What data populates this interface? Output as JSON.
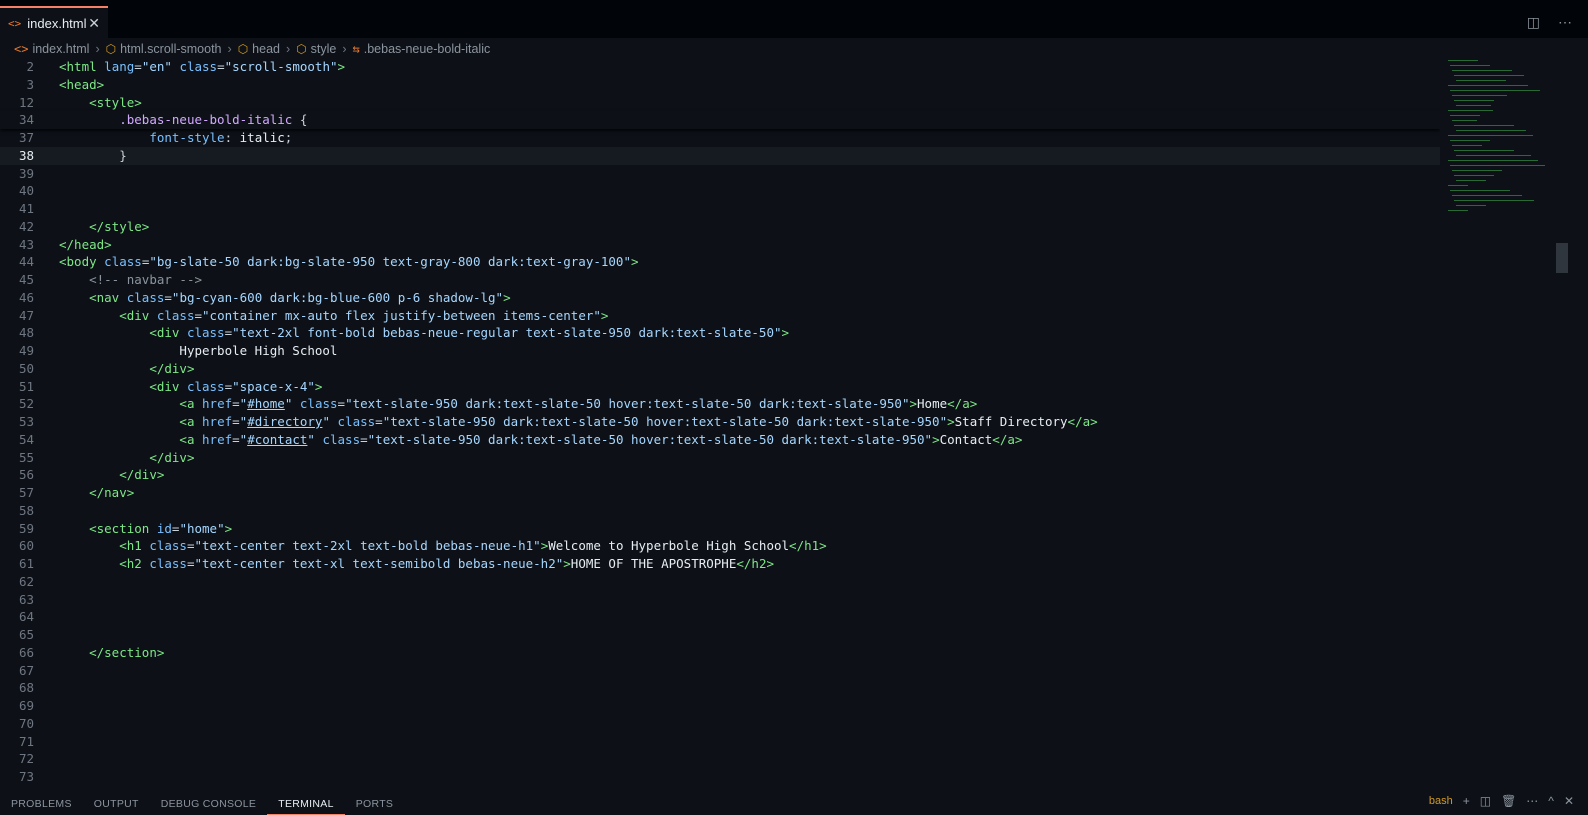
{
  "tab": {
    "icon": "<>",
    "title": "index.html",
    "close": "✕"
  },
  "tab_actions": {
    "split": "◫",
    "more": "⋯"
  },
  "breadcrumb": [
    {
      "icon": "<>",
      "label": "index.html"
    },
    {
      "icon": "⬡",
      "label": "html.scroll-smooth"
    },
    {
      "icon": "⬡",
      "label": "head"
    },
    {
      "icon": "⬡",
      "label": "style"
    },
    {
      "icon": "⇆",
      "label": ".bebas-neue-bold-italic"
    }
  ],
  "lines": [
    {
      "n": "2",
      "t": [
        [
          "tag",
          "<html"
        ],
        [
          "punc",
          " "
        ],
        [
          "attr",
          "lang"
        ],
        [
          "punc",
          "="
        ],
        [
          "str",
          "\"en\""
        ],
        [
          "punc",
          " "
        ],
        [
          "attr",
          "class"
        ],
        [
          "punc",
          "="
        ],
        [
          "str",
          "\"scroll-smooth\""
        ],
        [
          "tag",
          ">"
        ]
      ]
    },
    {
      "n": "3",
      "t": [
        [
          "tag",
          "<head>"
        ]
      ]
    },
    {
      "n": "12",
      "t": [
        [
          "punc",
          "    "
        ],
        [
          "tag",
          "<style>"
        ]
      ]
    },
    {
      "n": "34",
      "t": [
        [
          "punc",
          "        "
        ],
        [
          "sel",
          ".bebas-neue-bold-italic"
        ],
        [
          "punc",
          " {"
        ]
      ]
    },
    {
      "n": "37",
      "t": [
        [
          "punc",
          "            "
        ],
        [
          "prop",
          "font-style"
        ],
        [
          "punc",
          ": "
        ],
        [
          "txt",
          "italic"
        ],
        [
          "punc",
          ";"
        ]
      ]
    },
    {
      "n": "38",
      "t": [
        [
          "punc",
          "        }"
        ]
      ],
      "current": true
    },
    {
      "n": "39",
      "t": []
    },
    {
      "n": "40",
      "t": []
    },
    {
      "n": "41",
      "t": []
    },
    {
      "n": "42",
      "t": [
        [
          "punc",
          "    "
        ],
        [
          "tag",
          "</style>"
        ]
      ]
    },
    {
      "n": "43",
      "t": [
        [
          "tag",
          "</head>"
        ]
      ]
    },
    {
      "n": "44",
      "t": [
        [
          "tag",
          "<body"
        ],
        [
          "punc",
          " "
        ],
        [
          "attr",
          "class"
        ],
        [
          "punc",
          "="
        ],
        [
          "str",
          "\"bg-slate-50 dark:bg-slate-950 text-gray-800 dark:text-gray-100\""
        ],
        [
          "tag",
          ">"
        ]
      ]
    },
    {
      "n": "45",
      "t": [
        [
          "punc",
          "    "
        ],
        [
          "cmt",
          "<!-- navbar -->"
        ]
      ]
    },
    {
      "n": "46",
      "t": [
        [
          "punc",
          "    "
        ],
        [
          "tag",
          "<nav"
        ],
        [
          "punc",
          " "
        ],
        [
          "attr",
          "class"
        ],
        [
          "punc",
          "="
        ],
        [
          "str",
          "\"bg-cyan-600 dark:bg-blue-600 p-6 shadow-lg\""
        ],
        [
          "tag",
          ">"
        ]
      ]
    },
    {
      "n": "47",
      "t": [
        [
          "punc",
          "        "
        ],
        [
          "tag",
          "<div"
        ],
        [
          "punc",
          " "
        ],
        [
          "attr",
          "class"
        ],
        [
          "punc",
          "="
        ],
        [
          "str",
          "\"container mx-auto flex justify-between items-center\""
        ],
        [
          "tag",
          ">"
        ]
      ]
    },
    {
      "n": "48",
      "t": [
        [
          "punc",
          "            "
        ],
        [
          "tag",
          "<div"
        ],
        [
          "punc",
          " "
        ],
        [
          "attr",
          "class"
        ],
        [
          "punc",
          "="
        ],
        [
          "str",
          "\"text-2xl font-bold bebas-neue-regular text-slate-950 dark:text-slate-50\""
        ],
        [
          "tag",
          ">"
        ]
      ]
    },
    {
      "n": "49",
      "t": [
        [
          "punc",
          "                "
        ],
        [
          "txt",
          "Hyperbole High School"
        ]
      ]
    },
    {
      "n": "50",
      "t": [
        [
          "punc",
          "            "
        ],
        [
          "tag",
          "</div>"
        ]
      ]
    },
    {
      "n": "51",
      "t": [
        [
          "punc",
          "            "
        ],
        [
          "tag",
          "<div"
        ],
        [
          "punc",
          " "
        ],
        [
          "attr",
          "class"
        ],
        [
          "punc",
          "="
        ],
        [
          "str",
          "\"space-x-4\""
        ],
        [
          "tag",
          ">"
        ]
      ]
    },
    {
      "n": "52",
      "t": [
        [
          "punc",
          "                "
        ],
        [
          "tag",
          "<a"
        ],
        [
          "punc",
          " "
        ],
        [
          "attr",
          "href"
        ],
        [
          "punc",
          "="
        ],
        [
          "str",
          "\""
        ],
        [
          "stru",
          "#home"
        ],
        [
          "str",
          "\""
        ],
        [
          "punc",
          " "
        ],
        [
          "attr",
          "class"
        ],
        [
          "punc",
          "="
        ],
        [
          "str",
          "\"text-slate-950 dark:text-slate-50 hover:text-slate-50 dark:text-slate-950\""
        ],
        [
          "tag",
          ">"
        ],
        [
          "txt",
          "Home"
        ],
        [
          "tag",
          "</a>"
        ]
      ]
    },
    {
      "n": "53",
      "t": [
        [
          "punc",
          "                "
        ],
        [
          "tag",
          "<a"
        ],
        [
          "punc",
          " "
        ],
        [
          "attr",
          "href"
        ],
        [
          "punc",
          "="
        ],
        [
          "str",
          "\""
        ],
        [
          "stru",
          "#directory"
        ],
        [
          "str",
          "\""
        ],
        [
          "punc",
          " "
        ],
        [
          "attr",
          "class"
        ],
        [
          "punc",
          "="
        ],
        [
          "str",
          "\"text-slate-950 dark:text-slate-50 hover:text-slate-50 dark:text-slate-950\""
        ],
        [
          "tag",
          ">"
        ],
        [
          "txt",
          "Staff Directory"
        ],
        [
          "tag",
          "</a>"
        ]
      ]
    },
    {
      "n": "54",
      "t": [
        [
          "punc",
          "                "
        ],
        [
          "tag",
          "<a"
        ],
        [
          "punc",
          " "
        ],
        [
          "attr",
          "href"
        ],
        [
          "punc",
          "="
        ],
        [
          "str",
          "\""
        ],
        [
          "stru",
          "#contact"
        ],
        [
          "str",
          "\""
        ],
        [
          "punc",
          " "
        ],
        [
          "attr",
          "class"
        ],
        [
          "punc",
          "="
        ],
        [
          "str",
          "\"text-slate-950 dark:text-slate-50 hover:text-slate-50 dark:text-slate-950\""
        ],
        [
          "tag",
          ">"
        ],
        [
          "txt",
          "Contact"
        ],
        [
          "tag",
          "</a>"
        ]
      ]
    },
    {
      "n": "55",
      "t": [
        [
          "punc",
          "            "
        ],
        [
          "tag",
          "</div>"
        ]
      ]
    },
    {
      "n": "56",
      "t": [
        [
          "punc",
          "        "
        ],
        [
          "tag",
          "</div>"
        ]
      ]
    },
    {
      "n": "57",
      "t": [
        [
          "punc",
          "    "
        ],
        [
          "tag",
          "</nav>"
        ]
      ]
    },
    {
      "n": "58",
      "t": []
    },
    {
      "n": "59",
      "t": [
        [
          "punc",
          "    "
        ],
        [
          "tag",
          "<section"
        ],
        [
          "punc",
          " "
        ],
        [
          "attr",
          "id"
        ],
        [
          "punc",
          "="
        ],
        [
          "str",
          "\"home\""
        ],
        [
          "tag",
          ">"
        ]
      ]
    },
    {
      "n": "60",
      "t": [
        [
          "punc",
          "        "
        ],
        [
          "tag",
          "<h1"
        ],
        [
          "punc",
          " "
        ],
        [
          "attr",
          "class"
        ],
        [
          "punc",
          "="
        ],
        [
          "str",
          "\"text-center text-2xl text-bold bebas-neue-h1\""
        ],
        [
          "tag",
          ">"
        ],
        [
          "txt",
          "Welcome to Hyperbole High School"
        ],
        [
          "tag",
          "</h1>"
        ]
      ]
    },
    {
      "n": "61",
      "t": [
        [
          "punc",
          "        "
        ],
        [
          "tag",
          "<h2"
        ],
        [
          "punc",
          " "
        ],
        [
          "attr",
          "class"
        ],
        [
          "punc",
          "="
        ],
        [
          "str",
          "\"text-center text-xl text-semibold bebas-neue-h2\""
        ],
        [
          "tag",
          ">"
        ],
        [
          "txt",
          "HOME OF THE APOSTROPHE"
        ],
        [
          "tag",
          "</h2>"
        ]
      ]
    },
    {
      "n": "62",
      "t": []
    },
    {
      "n": "63",
      "t": []
    },
    {
      "n": "64",
      "t": []
    },
    {
      "n": "65",
      "t": []
    },
    {
      "n": "66",
      "t": [
        [
          "punc",
          "    "
        ],
        [
          "tag",
          "</section>"
        ]
      ]
    },
    {
      "n": "67",
      "t": []
    },
    {
      "n": "68",
      "t": []
    },
    {
      "n": "69",
      "t": []
    },
    {
      "n": "70",
      "t": []
    },
    {
      "n": "71",
      "t": []
    },
    {
      "n": "72",
      "t": []
    },
    {
      "n": "73",
      "t": []
    }
  ],
  "panel_tabs": [
    "PROBLEMS",
    "OUTPUT",
    "DEBUG CONSOLE",
    "TERMINAL",
    "PORTS"
  ],
  "panel_active": "TERMINAL",
  "terminal": {
    "shell": "bash",
    "add": "+",
    "split": "◫",
    "trash": "🗑",
    "more": "⋯",
    "max": "^",
    "close": "✕"
  }
}
